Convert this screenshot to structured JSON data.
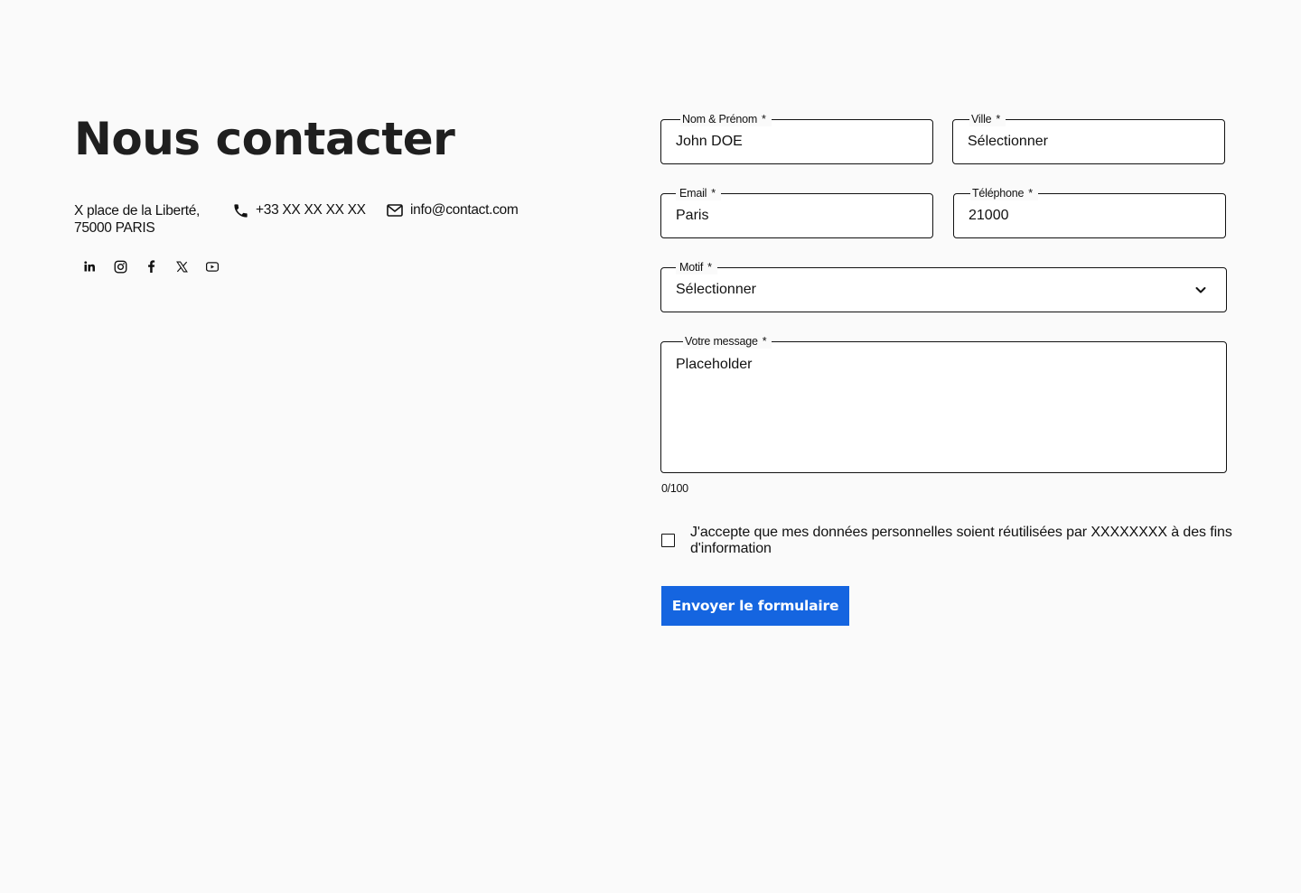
{
  "page": {
    "title": "Nous contacter"
  },
  "contact": {
    "address_line1": "X place de la Liberté,",
    "address_line2": "75000 PARIS",
    "phone": "+33 XX XX XX XX",
    "email": "info@contact.com",
    "icons": [
      "phone-icon",
      "mail-icon"
    ]
  },
  "socials": [
    {
      "name": "linkedin",
      "icon": "linkedin-icon"
    },
    {
      "name": "instagram",
      "icon": "instagram-icon"
    },
    {
      "name": "facebook",
      "icon": "facebook-icon"
    },
    {
      "name": "x",
      "icon": "x-icon"
    },
    {
      "name": "youtube",
      "icon": "youtube-icon"
    }
  ],
  "form": {
    "required_mark": "*",
    "nom": {
      "label": "Nom & Prénom",
      "value": "John DOE"
    },
    "ville": {
      "label": "Ville",
      "value": "Sélectionner"
    },
    "email": {
      "label": "Email",
      "value": "Paris"
    },
    "telephone": {
      "label": "Téléphone",
      "value": "21000"
    },
    "motif": {
      "label": "Motif",
      "value": "Sélectionner"
    },
    "message": {
      "label": "Votre message",
      "placeholder": "Placeholder",
      "counter": "0/100"
    },
    "consent": {
      "checked": false,
      "text": "J'accepte que mes données personnelles soient réutilisées par XXXXXXXX à des fins d'information"
    },
    "submit_label": "Envoyer le formulaire"
  },
  "colors": {
    "background": "#fafafa",
    "primary": "#1565e0",
    "text": "#111111"
  }
}
